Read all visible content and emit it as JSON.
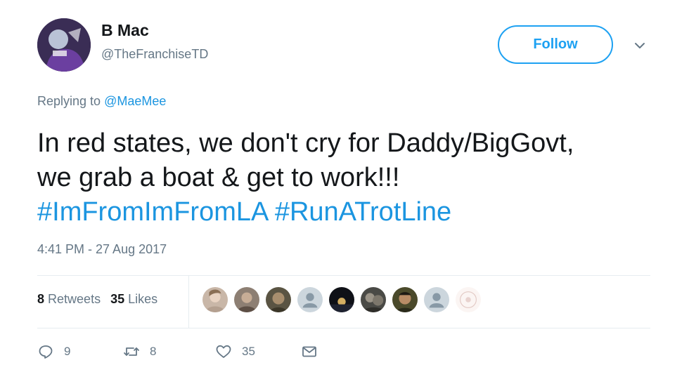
{
  "author": {
    "display_name": "B Mac",
    "handle": "@TheFranchiseTD",
    "avatar_icon": "profile-photo-icon"
  },
  "follow_label": "Follow",
  "menu_icon": "chevron-down-icon",
  "reply_context": {
    "prefix": "Replying to",
    "mention": "@MaeMee"
  },
  "tweet": {
    "line1": "In red states, we don't cry for Daddy/BigGovt,",
    "line2": "we grab a boat & get to work!!!",
    "hashtag1": "#ImFromImFromLA",
    "hashtag2": "#RunATrotLine"
  },
  "timestamp": "4:41 PM - 27 Aug 2017",
  "stats": {
    "retweets_count": "8",
    "retweets_label": "Retweets",
    "likes_count": "35",
    "likes_label": "Likes"
  },
  "likers_count_shown": 9,
  "actions": {
    "reply_count": "9",
    "retweet_count": "8",
    "like_count": "35"
  },
  "colors": {
    "accent": "#1da1f2",
    "link": "#1b95e0",
    "secondary_text": "#657786",
    "primary_text": "#14171a",
    "divider": "#e6ecf0"
  }
}
